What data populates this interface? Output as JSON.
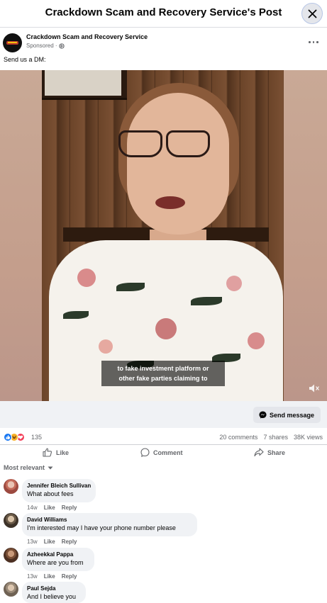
{
  "header": {
    "title": "Crackdown Scam and Recovery Service's Post",
    "close_icon": "close-icon"
  },
  "post": {
    "page_name": "Crackdown Scam and Recovery Service",
    "sponsored": "Sponsored ·",
    "privacy_icon": "globe-icon",
    "more_icon": "more-horizontal-icon",
    "text": "Send us a DM:"
  },
  "video": {
    "caption_line1": "to fake investment platform or",
    "caption_line2": "other fake parties claiming to",
    "mute_icon": "speaker-muted-icon"
  },
  "cta": {
    "label": "Send message",
    "icon": "messenger-icon"
  },
  "stats": {
    "reactions": [
      "like",
      "haha",
      "love"
    ],
    "reaction_count": "135",
    "comments": "20 comments",
    "shares": "7 shares",
    "views": "38K views"
  },
  "actions": {
    "like": "Like",
    "comment": "Comment",
    "share": "Share"
  },
  "comments_filter": "Most relevant",
  "comments": [
    {
      "name": "Jennifer Bleich Sullivan",
      "text": "What about fees",
      "time": "14w",
      "like": "Like",
      "reply": "Reply"
    },
    {
      "name": "David Williams",
      "text": "I'm interested may I have your phone number please",
      "time": "13w",
      "like": "Like",
      "reply": "Reply"
    },
    {
      "name": "Azheekkal Pappa",
      "text": "Where are you from",
      "time": "13w",
      "like": "Like",
      "reply": "Reply"
    },
    {
      "name": "Paul Sejda",
      "text": "And I believe you",
      "time": "",
      "like": "",
      "reply": ""
    }
  ],
  "colors": {
    "accent": "#1877f2",
    "love": "#f33e58",
    "haha": "#f7b125",
    "muted_text": "#65676b"
  }
}
